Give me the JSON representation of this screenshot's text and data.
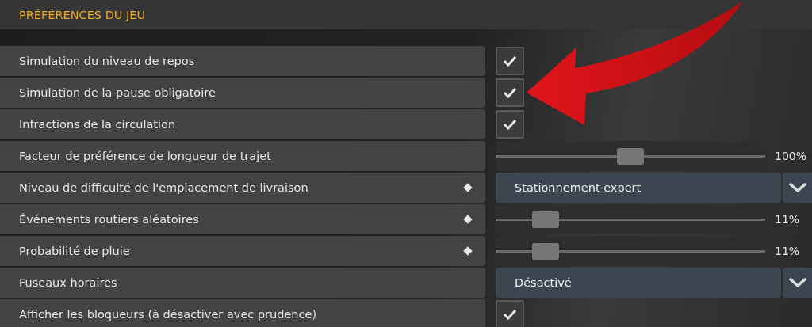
{
  "section": {
    "title": "PRÉFÉRENCES DU JEU"
  },
  "settings": [
    {
      "label": "Simulation du niveau de repos",
      "kind": "checkbox",
      "checked": true,
      "marked": false
    },
    {
      "label": "Simulation de la pause obligatoire",
      "kind": "checkbox",
      "checked": true,
      "marked": false
    },
    {
      "label": "Infractions de la circulation",
      "kind": "checkbox",
      "checked": true,
      "marked": false
    },
    {
      "label": "Facteur de préférence de longueur de trajet",
      "kind": "slider",
      "level": 0.5,
      "reading": "100%",
      "marked": false
    },
    {
      "label": "Niveau de difficulté de l'emplacement de livraison",
      "kind": "dropdown",
      "value": "Stationnement expert",
      "marked": true
    },
    {
      "label": "Événements routiers aléatoires",
      "kind": "slider",
      "level": 0.15,
      "reading": "11%",
      "marked": true
    },
    {
      "label": "Probabilité de pluie",
      "kind": "slider",
      "level": 0.15,
      "reading": "11%",
      "marked": true
    },
    {
      "label": "Fuseaux horaires",
      "kind": "dropdown",
      "value": "Désactivé",
      "marked": false
    },
    {
      "label": "Afficher les bloqueurs (à désactiver avec prudence)",
      "kind": "checkbox",
      "checked": true,
      "marked": false
    }
  ]
}
